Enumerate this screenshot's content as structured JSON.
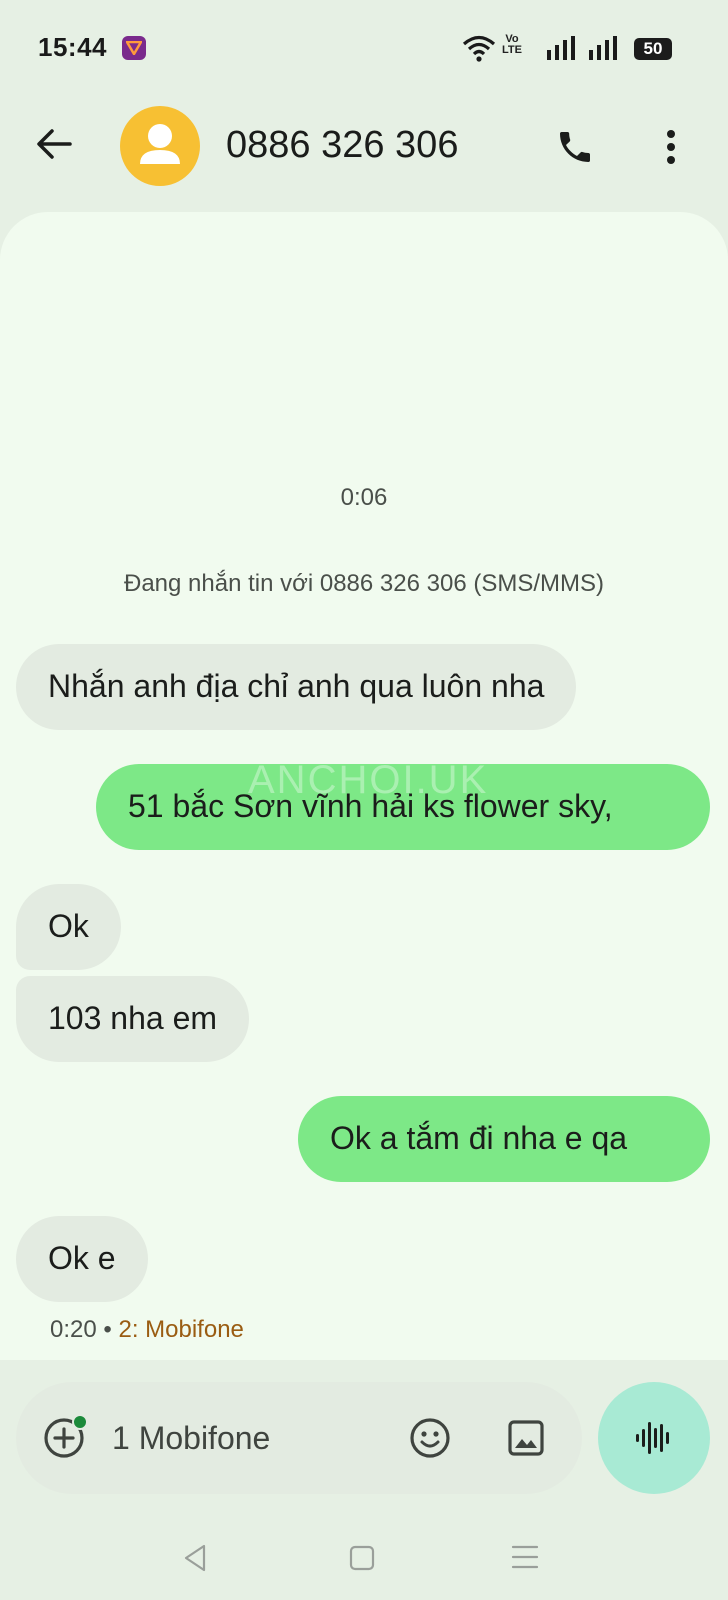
{
  "status_bar": {
    "time": "15:44",
    "volte_top": "Vo",
    "volte_bottom": "LTE",
    "battery": "50"
  },
  "header": {
    "contact": "0886 326 306",
    "icons": [
      "back-arrow-icon",
      "avatar-person-icon",
      "phone-icon",
      "more-vert-icon"
    ]
  },
  "conversation": {
    "timestamp": "0:06",
    "info": "Đang nhắn tin với 0886 326 306 (SMS/MMS)",
    "watermark": "ANCHOI.UK",
    "messages": [
      {
        "direction": "incoming",
        "text": "Nhắn anh địa chỉ anh qua luôn nha"
      },
      {
        "direction": "outgoing",
        "text": "51 bắc Sơn vĩnh hải ks flower sky,"
      },
      {
        "direction": "incoming",
        "text": "Ok"
      },
      {
        "direction": "incoming",
        "text": "103 nha em"
      },
      {
        "direction": "outgoing",
        "text": "Ok a tắm đi nha e qa"
      },
      {
        "direction": "incoming",
        "text": "Ok e"
      }
    ],
    "last_time": "0:20",
    "separator": "•",
    "sim": "2: Mobifone"
  },
  "compose": {
    "placeholder": "1 Mobifone",
    "icons": [
      "add-icon",
      "emoji-icon",
      "gallery-icon",
      "voice-wave-icon"
    ]
  },
  "colors": {
    "background": "#e6f0e4",
    "panel": "#f1fbef",
    "incoming_bubble": "#e3ebe1",
    "outgoing_bubble": "#7de887",
    "avatar": "#f7c033",
    "voice_button": "#a8ead4",
    "sim_label": "#9a5c12"
  }
}
